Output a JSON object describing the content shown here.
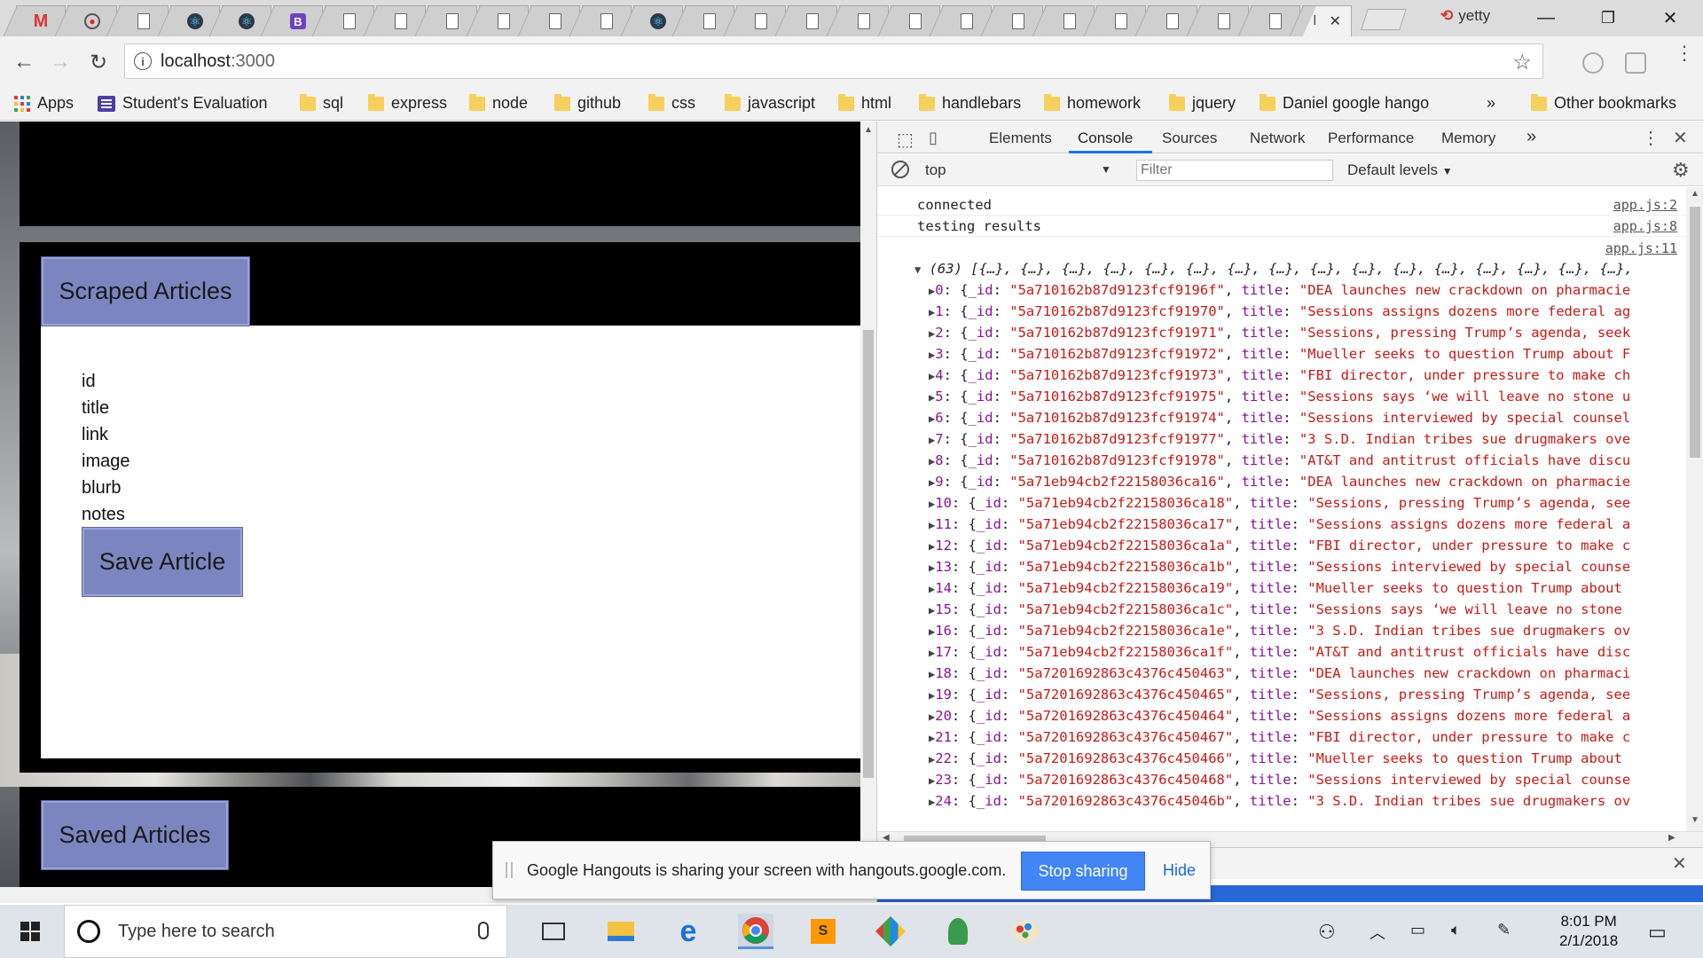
{
  "browser": {
    "url_host": "localhost",
    "url_port": ":3000",
    "profile_name": "yetty",
    "active_tab_title": "I"
  },
  "bookmarks": {
    "items": [
      {
        "label": "Apps",
        "icon": "apps-grid-icon"
      },
      {
        "label": "Student's Evaluation",
        "icon": "evaluation-icon"
      },
      {
        "label": "sql",
        "icon": "folder-icon"
      },
      {
        "label": "express",
        "icon": "folder-icon"
      },
      {
        "label": "node",
        "icon": "folder-icon"
      },
      {
        "label": "github",
        "icon": "folder-icon"
      },
      {
        "label": "css",
        "icon": "folder-icon"
      },
      {
        "label": "javascript",
        "icon": "folder-icon"
      },
      {
        "label": "html",
        "icon": "folder-icon"
      },
      {
        "label": "handlebars",
        "icon": "folder-icon"
      },
      {
        "label": "homework",
        "icon": "folder-icon"
      },
      {
        "label": "jquery",
        "icon": "folder-icon"
      },
      {
        "label": "Daniel google hango",
        "icon": "folder-icon"
      }
    ],
    "overflow": "»",
    "other": "Other bookmarks"
  },
  "page": {
    "scraped_title": "Scraped Articles",
    "fields": [
      "id",
      "title",
      "link",
      "image",
      "blurb",
      "notes"
    ],
    "save_button": "Save Article",
    "saved_title": "Saved Articles"
  },
  "devtools": {
    "tabs": [
      "Elements",
      "Console",
      "Sources",
      "Network",
      "Performance",
      "Memory"
    ],
    "active_tab": "Console",
    "more_tabs": "»",
    "context": "top",
    "filter_placeholder": "Filter",
    "levels": "Default levels",
    "logs": [
      {
        "text": "connected",
        "source": "app.js:2"
      },
      {
        "text": "testing results",
        "source": "app.js:8"
      },
      {
        "text": "",
        "source": "app.js:11"
      }
    ],
    "array_header": "(63) [{…}, {…}, {…}, {…}, {…}, {…}, {…}, {…}, {…}, {…}, {…}, {…}, {…}, {…}, {…}, {…},",
    "entries": [
      {
        "index": "0",
        "id": "\"5a710162b87d9123fcf9196f\"",
        "title": "\"DEA launches new crackdown on pharmacie"
      },
      {
        "index": "1",
        "id": "\"5a710162b87d9123fcf91970\"",
        "title": "\"Sessions assigns dozens more federal ag"
      },
      {
        "index": "2",
        "id": "\"5a710162b87d9123fcf91971\"",
        "title": "\"Sessions, pressing Trump’s agenda, seek"
      },
      {
        "index": "3",
        "id": "\"5a710162b87d9123fcf91972\"",
        "title": "\"Mueller seeks to question Trump about F"
      },
      {
        "index": "4",
        "id": "\"5a710162b87d9123fcf91973\"",
        "title": "\"FBI director, under pressure to make ch"
      },
      {
        "index": "5",
        "id": "\"5a710162b87d9123fcf91975\"",
        "title": "\"Sessions says ‘we will leave no stone u"
      },
      {
        "index": "6",
        "id": "\"5a710162b87d9123fcf91974\"",
        "title": "\"Sessions interviewed by special counsel"
      },
      {
        "index": "7",
        "id": "\"5a710162b87d9123fcf91977\"",
        "title": "\"3 S.D. Indian tribes sue drugmakers ove"
      },
      {
        "index": "8",
        "id": "\"5a710162b87d9123fcf91978\"",
        "title": "\"AT&T and antitrust officials have discu"
      },
      {
        "index": "9",
        "id": "\"5a71eb94cb2f22158036ca16\"",
        "title": "\"DEA launches new crackdown on pharmacie"
      },
      {
        "index": "10",
        "id": "\"5a71eb94cb2f22158036ca18\"",
        "title": "\"Sessions, pressing Trump’s agenda, see"
      },
      {
        "index": "11",
        "id": "\"5a71eb94cb2f22158036ca17\"",
        "title": "\"Sessions assigns dozens more federal a"
      },
      {
        "index": "12",
        "id": "\"5a71eb94cb2f22158036ca1a\"",
        "title": "\"FBI director, under pressure to make c"
      },
      {
        "index": "13",
        "id": "\"5a71eb94cb2f22158036ca1b\"",
        "title": "\"Sessions interviewed by special counse"
      },
      {
        "index": "14",
        "id": "\"5a71eb94cb2f22158036ca19\"",
        "title": "\"Mueller seeks to question Trump about"
      },
      {
        "index": "15",
        "id": "\"5a71eb94cb2f22158036ca1c\"",
        "title": "\"Sessions says ‘we will leave no stone"
      },
      {
        "index": "16",
        "id": "\"5a71eb94cb2f22158036ca1e\"",
        "title": "\"3 S.D. Indian tribes sue drugmakers ov"
      },
      {
        "index": "17",
        "id": "\"5a71eb94cb2f22158036ca1f\"",
        "title": "\"AT&T and antitrust officials have disc"
      },
      {
        "index": "18",
        "id": "\"5a7201692863c4376c450463\"",
        "title": "\"DEA launches new crackdown on pharmaci"
      },
      {
        "index": "19",
        "id": "\"5a7201692863c4376c450465\"",
        "title": "\"Sessions, pressing Trump’s agenda, see"
      },
      {
        "index": "20",
        "id": "\"5a7201692863c4376c450464\"",
        "title": "\"Sessions assigns dozens more federal a"
      },
      {
        "index": "21",
        "id": "\"5a7201692863c4376c450467\"",
        "title": "\"FBI director, under pressure to make c"
      },
      {
        "index": "22",
        "id": "\"5a7201692863c4376c450466\"",
        "title": "\"Mueller seeks to question Trump about"
      },
      {
        "index": "23",
        "id": "\"5a7201692863c4376c450468\"",
        "title": "\"Sessions interviewed by special counse"
      },
      {
        "index": "24",
        "id": "\"5a7201692863c4376c45046b\"",
        "title": "\"3 S.D. Indian tribes sue drugmakers ov"
      }
    ]
  },
  "hangouts": {
    "message": "Google Hangouts is sharing your screen with hangouts.google.com.",
    "stop_label": "Stop sharing",
    "hide_label": "Hide"
  },
  "taskbar": {
    "search_placeholder": "Type here to search",
    "time": "8:01 PM",
    "date": "2/1/2018"
  },
  "colors": {
    "button_blue": "#7b86c1",
    "console_key": "#881391",
    "console_string": "#c41a16",
    "stop_sharing": "#4285f4",
    "devtools_accent": "#1a73e8"
  }
}
